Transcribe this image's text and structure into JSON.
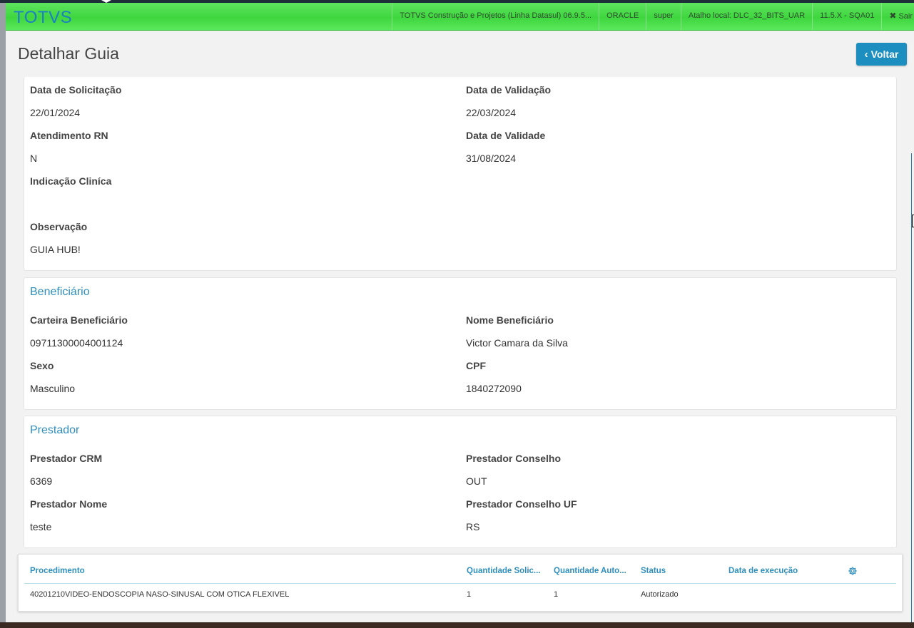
{
  "header": {
    "logo": "TOTVS",
    "items": [
      "TOTVS Construção e Projetos (Linha Datasul) 06.9.5...",
      "ORACLE",
      "super",
      "Atalho local: DLC_32_BITS_UAR",
      "11.5.X - SQA01"
    ],
    "exit_label": "Sair",
    "exit_icon": "close-icon"
  },
  "page": {
    "title": "Detalhar Guia",
    "back_label": "Voltar",
    "back_icon": "chevron-left-icon"
  },
  "details": {
    "data_solicitacao_label": "Data de Solicitação",
    "data_solicitacao": "22/01/2024",
    "data_validacao_label": "Data de Validação",
    "data_validacao": "22/03/2024",
    "atendimento_rn_label": "Atendimento RN",
    "atendimento_rn": "N",
    "data_validade_label": "Data de Validade",
    "data_validade": "31/08/2024",
    "indicacao_clinica_label": "Indicação Cliníca",
    "indicacao_clinica": "",
    "observacao_label": "Observação",
    "observacao": "GUIA HUB!"
  },
  "beneficiario": {
    "section_title": "Beneficiário",
    "carteira_label": "Carteira Beneficiário",
    "carteira": "09711300004001124",
    "nome_label": "Nome Beneficiário",
    "nome": "Victor Camara da Silva",
    "sexo_label": "Sexo",
    "sexo": "Masculino",
    "cpf_label": "CPF",
    "cpf": "1840272090"
  },
  "prestador": {
    "section_title": "Prestador",
    "crm_label": "Prestador CRM",
    "crm": "6369",
    "conselho_label": "Prestador Conselho",
    "conselho": "OUT",
    "nome_label": "Prestador Nome",
    "nome": "teste",
    "conselho_uf_label": "Prestador Conselho UF",
    "conselho_uf": "RS"
  },
  "procedimentos": {
    "columns": [
      "Procedimento",
      "Quantidade Solic...",
      "Quantidade Auto...",
      "Status",
      "Data de execução"
    ],
    "settings_icon": "gear-icon",
    "rows": [
      [
        "40201210VIDEO-ENDOSCOPIA NASO-SINUSAL COM OTICA FLEXIVEL",
        "1",
        "1",
        "Autorizado",
        ""
      ]
    ]
  },
  "colors": {
    "header_green": "#3fd63f",
    "logo_blue": "#1b7fc4",
    "accent": "#2e8fbf",
    "button": "#1c8fc0"
  }
}
